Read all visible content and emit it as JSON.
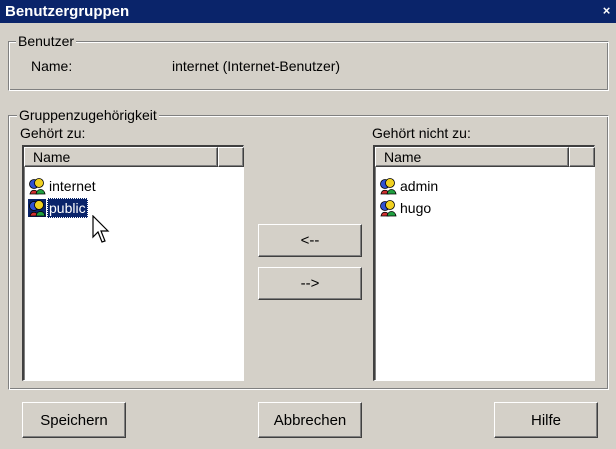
{
  "window": {
    "title": "Benutzergruppen",
    "close_glyph": "×"
  },
  "user_group": {
    "legend": "Benutzer",
    "name_label": "Name:",
    "name_value": "internet (Internet-Benutzer)"
  },
  "membership": {
    "legend": "Gruppenzugehörigkeit",
    "member_of_label": "Gehört zu:",
    "not_member_of_label": "Gehört nicht zu:",
    "column_header": "Name",
    "member_of_items": [
      {
        "label": "internet",
        "icon": "group-icon",
        "selected": false
      },
      {
        "label": "public",
        "icon": "group-icon",
        "selected": true
      }
    ],
    "not_member_of_items": [
      {
        "label": "admin",
        "icon": "group-icon",
        "selected": false
      },
      {
        "label": "hugo",
        "icon": "group-icon",
        "selected": false
      }
    ],
    "add_button": "<--",
    "remove_button": "-->"
  },
  "buttons": {
    "save": "Speichern",
    "cancel": "Abbrechen",
    "help": "Hilfe"
  },
  "colors": {
    "titlebar": "#0a246a",
    "face": "#d4d0c8",
    "selection": "#0a246a"
  }
}
